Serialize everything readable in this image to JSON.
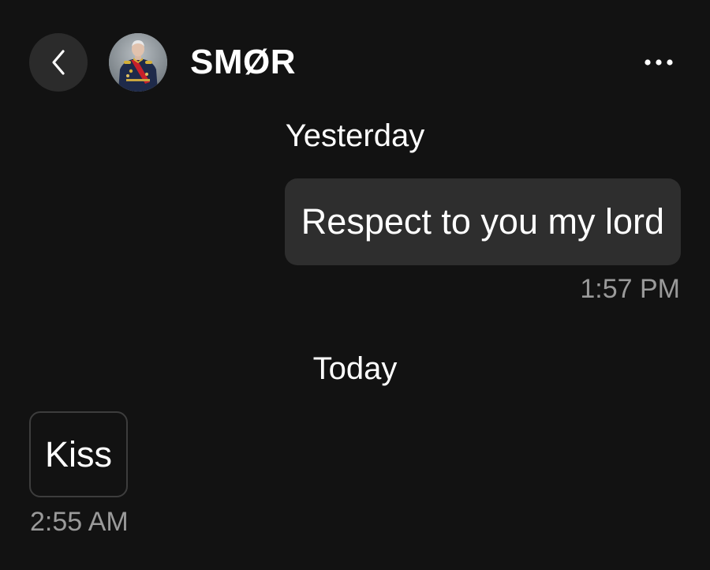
{
  "header": {
    "contact_name": "SMØR",
    "back_icon": "chevron-left-icon",
    "more_icon": "more-horizontal-icon"
  },
  "conversation": [
    {
      "day": "Yesterday",
      "messages": [
        {
          "direction": "outgoing",
          "text": "Respect to you my lord",
          "time": "1:57 PM"
        }
      ]
    },
    {
      "day": "Today",
      "messages": [
        {
          "direction": "incoming",
          "text": "Kiss",
          "time": "2:55 AM"
        }
      ]
    }
  ],
  "colors": {
    "background": "#121212",
    "outgoing_bubble": "#2e2e2e",
    "incoming_border": "#3d3d3d",
    "timestamp": "#9a9a9a"
  }
}
